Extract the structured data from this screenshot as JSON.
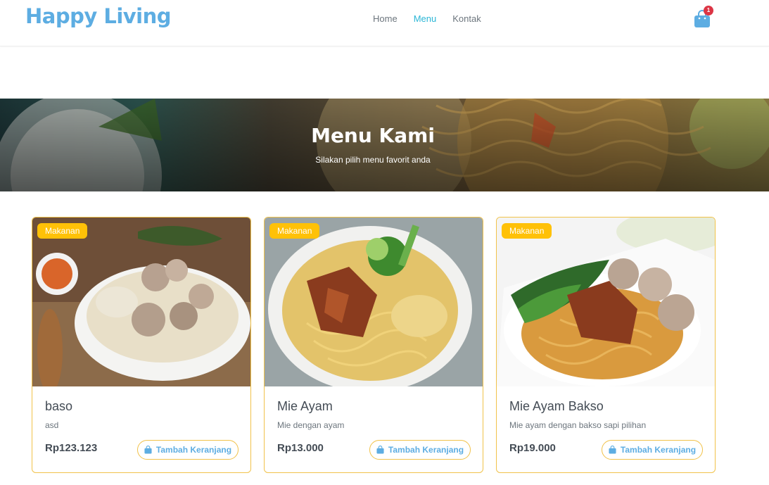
{
  "brand": "Happy Living",
  "nav": {
    "items": [
      "Home",
      "Menu",
      "Kontak"
    ],
    "active": "Menu"
  },
  "cart": {
    "count": "1",
    "icon": "shopping-bag-icon"
  },
  "hero": {
    "title": "Menu Kami",
    "subtitle": "Silakan pilih menu favorit anda"
  },
  "colors": {
    "brand": "#5dade2",
    "active_nav": "#2bb6d6",
    "badge": "#ffc107",
    "card_border": "#f1c24a",
    "cart_badge": "#dc3545"
  },
  "products": [
    {
      "category": "Makanan",
      "name": "baso",
      "description": "asd",
      "price": "Rp123.123",
      "button": "Tambah Keranjang"
    },
    {
      "category": "Makanan",
      "name": "Mie Ayam",
      "description": "Mie dengan ayam",
      "price": "Rp13.000",
      "button": "Tambah Keranjang"
    },
    {
      "category": "Makanan",
      "name": "Mie Ayam Bakso",
      "description": "Mie ayam dengan bakso sapi pilihan",
      "price": "Rp19.000",
      "button": "Tambah Keranjang"
    }
  ]
}
